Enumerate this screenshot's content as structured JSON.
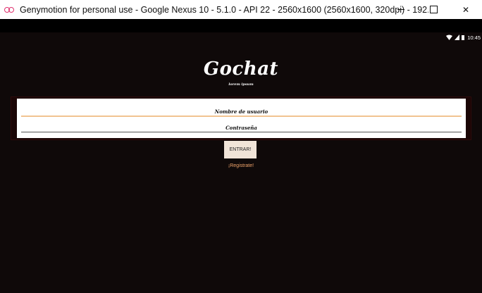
{
  "window": {
    "title": "Genymotion for personal use - Google Nexus 10 - 5.1.0 - API 22 - 2560x1600 (2560x1600, 320dpi) - 192.168.1...",
    "logo_icon": "genymotion-logo-icon",
    "minimize_icon": "minimize-icon",
    "maximize_icon": "maximize-icon",
    "close_glyph": "✕"
  },
  "statusbar": {
    "icons": [
      "wifi-icon",
      "signal-icon",
      "battery-icon"
    ],
    "time": "10:45"
  },
  "app": {
    "title": "Gochat",
    "tagline": "lorem ipsum",
    "username_placeholder": "Nombre de usuario",
    "password_placeholder": "Contraseña",
    "username_value": "",
    "password_value": "",
    "login_button": "ENTRAR!",
    "register_link": "¡Registrate!"
  },
  "colors": {
    "app_background": "#0f0909",
    "input_focus_underline": "#f1c391",
    "button_background": "#f0e4d8",
    "link_color": "#f0a46a"
  }
}
